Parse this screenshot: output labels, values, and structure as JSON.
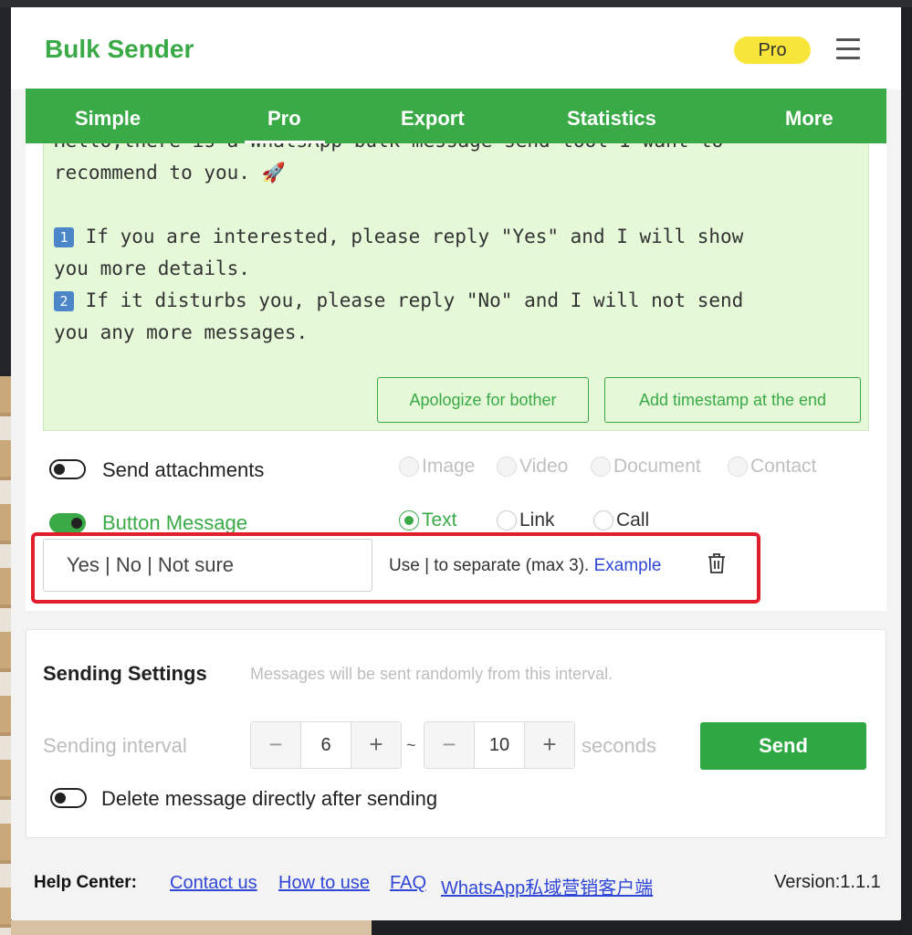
{
  "app": {
    "brand": "Bulk Sender",
    "badge": "Pro"
  },
  "tabs": [
    {
      "label": "Simple"
    },
    {
      "label": "Pro",
      "active": true
    },
    {
      "label": "Export"
    },
    {
      "label": "Statistics"
    },
    {
      "label": "More"
    }
  ],
  "message": {
    "line1": "Hello,there is a WhatsApp bulk message send tool I want to",
    "line2": "recommend to you. 🚀",
    "num1": "1",
    "line3a": " If you are interested, please reply \"Yes\" and I will show",
    "line3b": "you more details.",
    "num2": "2",
    "line4a": " If it disturbs you, please reply \"No\" and I will not send",
    "line4b": "you any more messages.",
    "apologize_button": "Apologize for bother",
    "timestamp_button": "Add timestamp at the end"
  },
  "attachments": {
    "label": "Send attachments",
    "enabled": false,
    "options": [
      "Image",
      "Video",
      "Document",
      "Contact"
    ]
  },
  "button_message": {
    "label": "Button Message",
    "enabled": true,
    "options": [
      "Text",
      "Link",
      "Call"
    ],
    "selected": "Text",
    "value": "Yes | No | Not sure",
    "hint": "Use | to separate (max 3). ",
    "example_link": "Example"
  },
  "sending_settings": {
    "title": "Sending Settings",
    "description": "Messages will be sent randomly from this interval.",
    "interval_label": "Sending interval",
    "min": "6",
    "max": "10",
    "separator": "~",
    "unit": "seconds",
    "send_button": "Send",
    "delete_label": "Delete message directly after sending",
    "delete_enabled": false
  },
  "footer": {
    "help_title": "Help Center:",
    "links": [
      "Contact us",
      "How to use",
      "FAQ",
      "WhatsApp私域营销客户端"
    ],
    "version": "Version:1.1.1"
  },
  "colors": {
    "brand": "#3aaa47",
    "badge": "#f7e53a",
    "highlight": "#e21d2c",
    "link": "#2f46d6"
  }
}
